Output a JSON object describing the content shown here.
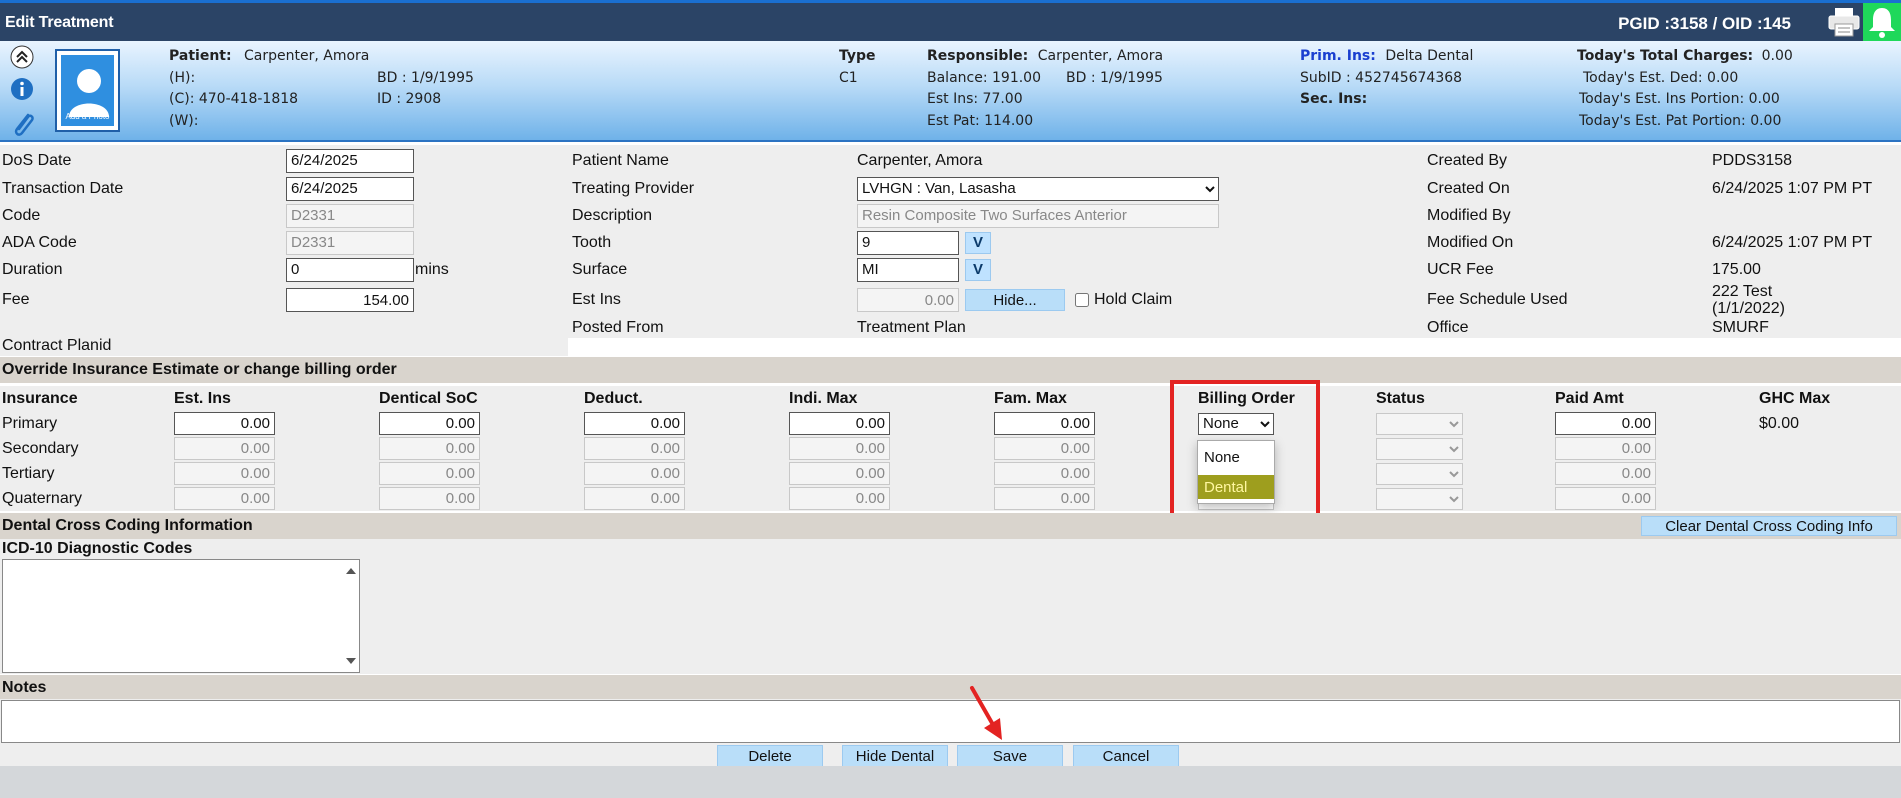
{
  "window": {
    "title": "Edit Treatment",
    "ids": "PGID :3158  /  OID :145"
  },
  "patient_header": {
    "patient_label": "Patient:",
    "patient_name": "Carpenter, Amora",
    "home_phone": "(H):",
    "cell_phone": "(C):  470-418-1818",
    "work_phone": "(W):",
    "birth_date": "BD : 1/9/1995",
    "id": "ID : 2908",
    "photo_label": "Add a Photo",
    "type_label": "Type",
    "type_value": "C1",
    "responsible_label": "Responsible:",
    "responsible_name": "Carpenter, Amora",
    "balance": "Balance: 191.00",
    "responsible_bd": "BD : 1/9/1995",
    "est_ins": "Est Ins:  77.00",
    "est_pat": "Est Pat: 114.00",
    "prim_ins_label": "Prim. Ins:",
    "prim_ins_value": "Delta Dental",
    "subid": "SubID : 452745674368",
    "sec_ins_label": "Sec. Ins:",
    "total_charges_label": "Today's Total Charges:",
    "total_charges_value": "0.00",
    "est_ded": "Today's Est. Ded:   0.00",
    "est_ins_portion": "Today's Est. Ins Portion: 0.00",
    "est_pat_portion": "Today's Est. Pat Portion: 0.00"
  },
  "form": {
    "dos_date_label": "DoS Date",
    "dos_date": "6/24/2025",
    "transaction_date_label": "Transaction Date",
    "transaction_date": "6/24/2025",
    "code_label": "Code",
    "code": "D2331",
    "ada_code_label": "ADA Code",
    "ada_code": "D2331",
    "duration_label": "Duration",
    "duration": "0",
    "duration_unit": "mins",
    "fee_label": "Fee",
    "fee": "154.00",
    "contract_planid_label": "Contract Planid",
    "patient_name_label": "Patient Name",
    "patient_name": "Carpenter, Amora",
    "treating_provider_label": "Treating Provider",
    "treating_provider": "LVHGN : Van, Lasasha",
    "description_label": "Description",
    "description": "Resin Composite Two Surfaces Anterior",
    "tooth_label": "Tooth",
    "tooth": "9",
    "surface_label": "Surface",
    "surface": "MI",
    "v_label": "V",
    "est_ins_label": "Est Ins",
    "est_ins": "0.00",
    "hide_label": "Hide...",
    "hold_claim_label": "Hold Claim",
    "posted_from_label": "Posted From",
    "posted_from": "Treatment Plan",
    "created_by_label": "Created By",
    "created_by": "PDDS3158",
    "created_on_label": "Created On",
    "created_on": "6/24/2025 1:07 PM PT",
    "modified_by_label": "Modified By",
    "modified_by": "",
    "modified_on_label": "Modified On",
    "modified_on": "6/24/2025 1:07 PM PT",
    "ucr_fee_label": "UCR Fee",
    "ucr_fee": "175.00",
    "fee_schedule_label": "Fee Schedule Used",
    "fee_schedule_line1": "222 Test",
    "fee_schedule_line2": "(1/1/2022)",
    "office_label": "Office",
    "office": "SMURF"
  },
  "insurance": {
    "section_title": "Override Insurance Estimate or change billing order",
    "headers": [
      "Insurance",
      "Est. Ins",
      "Dentical SoC",
      "Deduct.",
      "Indi. Max",
      "Fam. Max",
      "Billing Order",
      "Status",
      "Paid Amt",
      "GHC Max"
    ],
    "rows": [
      {
        "name": "Primary",
        "est_ins": "0.00",
        "soc": "0.00",
        "deduct": "0.00",
        "indi_max": "0.00",
        "fam_max": "0.00",
        "billing_order": "None",
        "paid": "0.00",
        "ghc": "$0.00"
      },
      {
        "name": "Secondary",
        "est_ins": "0.00",
        "soc": "0.00",
        "deduct": "0.00",
        "indi_max": "0.00",
        "fam_max": "0.00",
        "billing_order": "",
        "paid": "0.00",
        "ghc": ""
      },
      {
        "name": "Tertiary",
        "est_ins": "0.00",
        "soc": "0.00",
        "deduct": "0.00",
        "indi_max": "0.00",
        "fam_max": "0.00",
        "billing_order": "",
        "paid": "0.00",
        "ghc": ""
      },
      {
        "name": "Quaternary",
        "est_ins": "0.00",
        "soc": "0.00",
        "deduct": "0.00",
        "indi_max": "0.00",
        "fam_max": "0.00",
        "billing_order": "None",
        "paid": "0.00",
        "ghc": ""
      }
    ],
    "billing_options": [
      "None",
      "Dental"
    ],
    "highlighted_option": "Dental"
  },
  "cross_coding": {
    "section_title": "Dental Cross Coding Information",
    "clear_button": "Clear Dental Cross Coding Info",
    "icd_label": "ICD-10 Diagnostic Codes",
    "icd_value": ""
  },
  "notes": {
    "label": "Notes",
    "value": ""
  },
  "actions": {
    "delete": "Delete",
    "hide_dental": "Hide Dental",
    "save": "Save",
    "cancel": "Cancel"
  },
  "colors": {
    "title_bar": "#2b4466",
    "highlight_box": "#e32322",
    "button_bg": "#b9def9",
    "notification": "#1fd85a"
  }
}
